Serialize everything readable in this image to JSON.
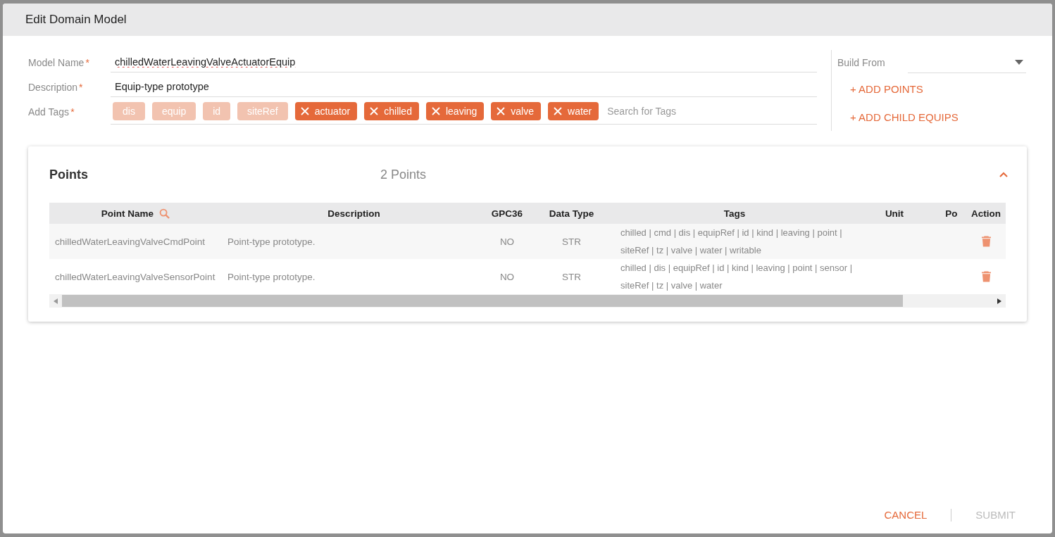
{
  "dialog": {
    "title": "Edit Domain Model"
  },
  "form": {
    "model_name": {
      "label": "Model Name",
      "required_mark": "*",
      "value": "chilledWaterLeavingValveActuatorEquip"
    },
    "description": {
      "label": "Description",
      "required_mark": "*",
      "value": "Equip-type prototype"
    },
    "tags": {
      "label": "Add Tags",
      "required_mark": "*",
      "placeholder": "Search for Tags",
      "items": [
        {
          "label": "dis",
          "removable": false
        },
        {
          "label": "equip",
          "removable": false
        },
        {
          "label": "id",
          "removable": false
        },
        {
          "label": "siteRef",
          "removable": false
        },
        {
          "label": "actuator",
          "removable": true
        },
        {
          "label": "chilled",
          "removable": true
        },
        {
          "label": "leaving",
          "removable": true
        },
        {
          "label": "valve",
          "removable": true
        },
        {
          "label": "water",
          "removable": true
        }
      ]
    }
  },
  "side": {
    "build_from_label": "Build From",
    "actions": [
      "+ ADD POINTS",
      "+ ADD CHILD EQUIPS"
    ]
  },
  "points": {
    "title": "Points",
    "count": "2 Points",
    "expanded": true,
    "columns": [
      "Point Name",
      "Description",
      "GPC36",
      "Data Type",
      "Tags",
      "Unit",
      "Po",
      "Action"
    ],
    "rows": [
      {
        "name": "chilledWaterLeavingValveCmdPoint",
        "description": "Point-type prototype.",
        "gpc36": "NO",
        "data_type": "STR",
        "tags": [
          "chilled | cmd | dis | equipRef | id | kind | leaving | point |",
          "siteRef | tz | valve | water | writable"
        ]
      },
      {
        "name": "chilledWaterLeavingValveSensorPoint",
        "description": "Point-type prototype.",
        "gpc36": "NO",
        "data_type": "STR",
        "tags": [
          "chilled | dis | equipRef | id | kind | leaving | point | sensor |",
          "siteRef | tz | valve | water"
        ]
      }
    ]
  },
  "footer": {
    "buttons": [
      {
        "label": "CANCEL",
        "disabled": false
      },
      {
        "label": "SUBMIT",
        "disabled": true
      }
    ]
  }
}
